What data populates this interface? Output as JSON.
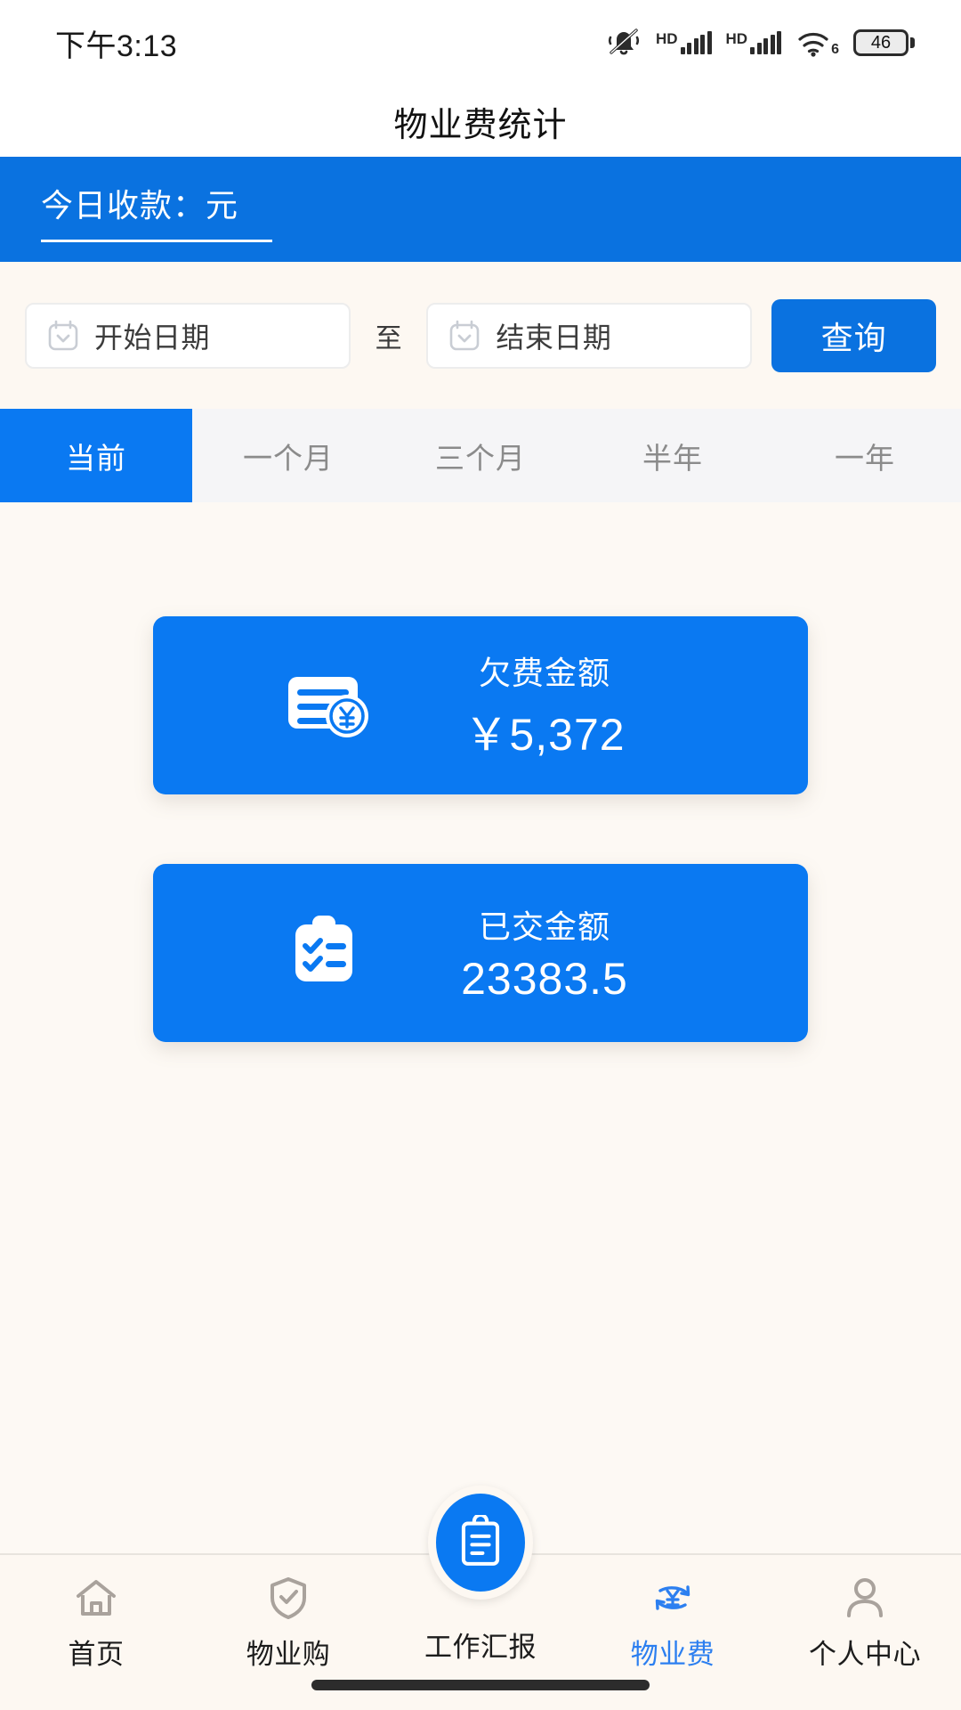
{
  "status_bar": {
    "time": "下午3:13",
    "hd_label_1": "HD",
    "hd_label_2": "HD",
    "wifi_generation": "6",
    "battery_level": "46",
    "icons": [
      "bell-muted-icon",
      "hd-signal-icon",
      "hd-signal-icon",
      "wifi-6-icon",
      "battery-icon"
    ]
  },
  "header": {
    "title": "物业费统计"
  },
  "banner": {
    "text": "今日收款：元"
  },
  "filter": {
    "start_date_placeholder": "开始日期",
    "start_date_value": "",
    "separator": "至",
    "end_date_placeholder": "结束日期",
    "end_date_value": "",
    "query_label": "查询"
  },
  "tabs": {
    "active_index": 0,
    "items": [
      {
        "label": "当前"
      },
      {
        "label": "一个月"
      },
      {
        "label": "三个月"
      },
      {
        "label": "半年"
      },
      {
        "label": "一年"
      }
    ]
  },
  "stats": {
    "cards": [
      {
        "label": "欠费金额",
        "value": "￥5,372",
        "icon": "bill-yuan-icon"
      },
      {
        "label": "已交金额",
        "value": "23383.5",
        "icon": "clipboard-check-icon"
      }
    ]
  },
  "bottom_nav": {
    "active_index": 3,
    "items": [
      {
        "label": "首页",
        "icon": "home-icon"
      },
      {
        "label": "物业购",
        "icon": "shield-check-icon"
      },
      {
        "label": "工作汇报",
        "icon": "clipboard-icon"
      },
      {
        "label": "物业费",
        "icon": "yuan-refresh-icon"
      },
      {
        "label": "个人中心",
        "icon": "person-icon"
      }
    ]
  },
  "colors": {
    "primary_blue": "#0a79f2",
    "banner_blue": "#0a72e0",
    "page_background": "#fdf9f4",
    "tab_background": "#f5f5f7",
    "inactive_text": "#8b8b8b"
  }
}
